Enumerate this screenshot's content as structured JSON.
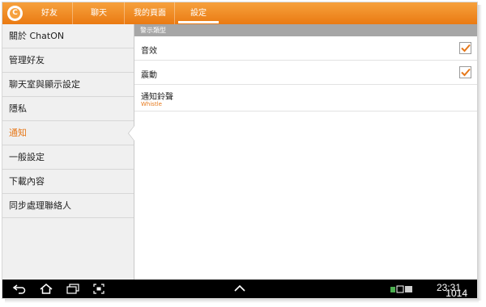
{
  "tabs": [
    {
      "label": "好友"
    },
    {
      "label": "聊天"
    },
    {
      "label": "我的頁面"
    },
    {
      "label": "設定",
      "active": true
    }
  ],
  "sidebar": {
    "items": [
      {
        "label": "關於 ChatON"
      },
      {
        "label": "管理好友"
      },
      {
        "label": "聊天室與顯示設定"
      },
      {
        "label": "隱私"
      },
      {
        "label": "通知",
        "selected": true
      },
      {
        "label": "一般設定"
      },
      {
        "label": "下載內容"
      },
      {
        "label": "同步處理聯絡人"
      }
    ]
  },
  "main": {
    "section_title": "警示類型",
    "sound": {
      "label": "音效",
      "checked": true
    },
    "vibrate": {
      "label": "震動",
      "checked": true
    },
    "ringtone": {
      "label": "通知鈴聲",
      "value": "Whistle"
    }
  },
  "status_bar": {
    "time": "23:31"
  },
  "watermark": "1014",
  "colors": {
    "accent": "#ea7a12",
    "accent_text": "#e6781a",
    "section_header": "#a6a6a6",
    "navbar": "#000000"
  },
  "icons": {
    "app": "chaton-logo-icon",
    "back": "back-icon",
    "home": "home-icon",
    "recents": "recent-apps-icon",
    "screenshot": "screenshot-icon",
    "up": "chevron-up-icon",
    "check": "check-icon"
  }
}
